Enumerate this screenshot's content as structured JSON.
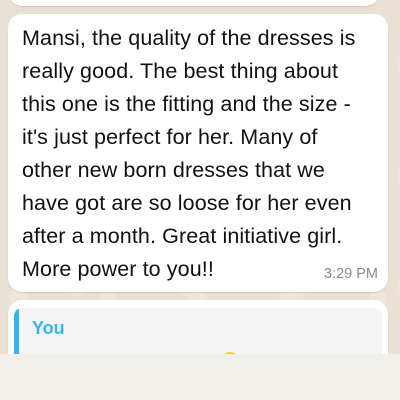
{
  "chat": {
    "message": {
      "text": "Mansi, the quality of the dresses is\nreally good. The best thing about\nthis one is the fitting and the size -\nit's just perfect for her. Many of\nother new born dresses that we\nhave got are so loose for her even\nafter a month. Great initiative girl.\nMore power to you!!",
      "time": "3:29 PM"
    },
    "reply": {
      "sender": "You"
    }
  },
  "colors": {
    "background": "#e9e1d3",
    "bubble": "#ffffff",
    "quote_accent": "#34b7f1",
    "timestamp": "#8a8a8a"
  }
}
